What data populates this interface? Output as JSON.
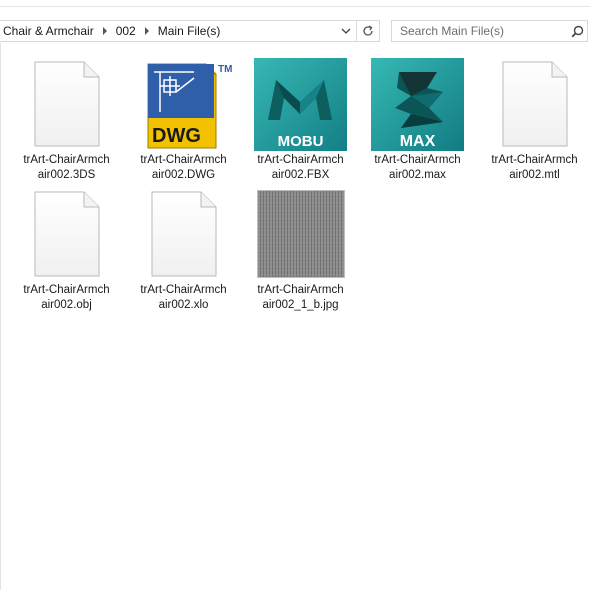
{
  "address": {
    "crumbs": [
      "Chair & Armchair",
      "002",
      "Main File(s)"
    ],
    "dropdown_icon": "chevron-down-icon",
    "refresh_icon": "refresh-icon"
  },
  "search": {
    "placeholder": "Search Main File(s)",
    "icon": "search-icon"
  },
  "files": [
    {
      "line1": "trArt-ChairArmch",
      "line2": "air002.3DS",
      "icon": "blank-document-icon"
    },
    {
      "line1": "trArt-ChairArmch",
      "line2": "air002.DWG",
      "icon": "dwg-file-icon",
      "badge": "DWG",
      "tm": "TM"
    },
    {
      "line1": "trArt-ChairArmch",
      "line2": "air002.FBX",
      "icon": "motionbuilder-icon",
      "badge": "MOBU"
    },
    {
      "line1": "trArt-ChairArmch",
      "line2": "air002.max",
      "icon": "3dsmax-icon",
      "badge": "MAX"
    },
    {
      "line1": "trArt-ChairArmch",
      "line2": "air002.mtl",
      "icon": "blank-document-icon"
    },
    {
      "line1": "trArt-ChairArmch",
      "line2": "air002.obj",
      "icon": "blank-document-icon"
    },
    {
      "line1": "trArt-ChairArmch",
      "line2": "air002.xlo",
      "icon": "blank-document-icon"
    },
    {
      "line1": "trArt-ChairArmch",
      "line2": "air002_1_b.jpg",
      "icon": "texture-thumbnail"
    }
  ],
  "colors": {
    "dwg_yellow": "#f2c200",
    "dwg_blue": "#2f5fa8",
    "mobu_teal": "#1f9ea1",
    "max_teal": "#1b9a9a"
  }
}
